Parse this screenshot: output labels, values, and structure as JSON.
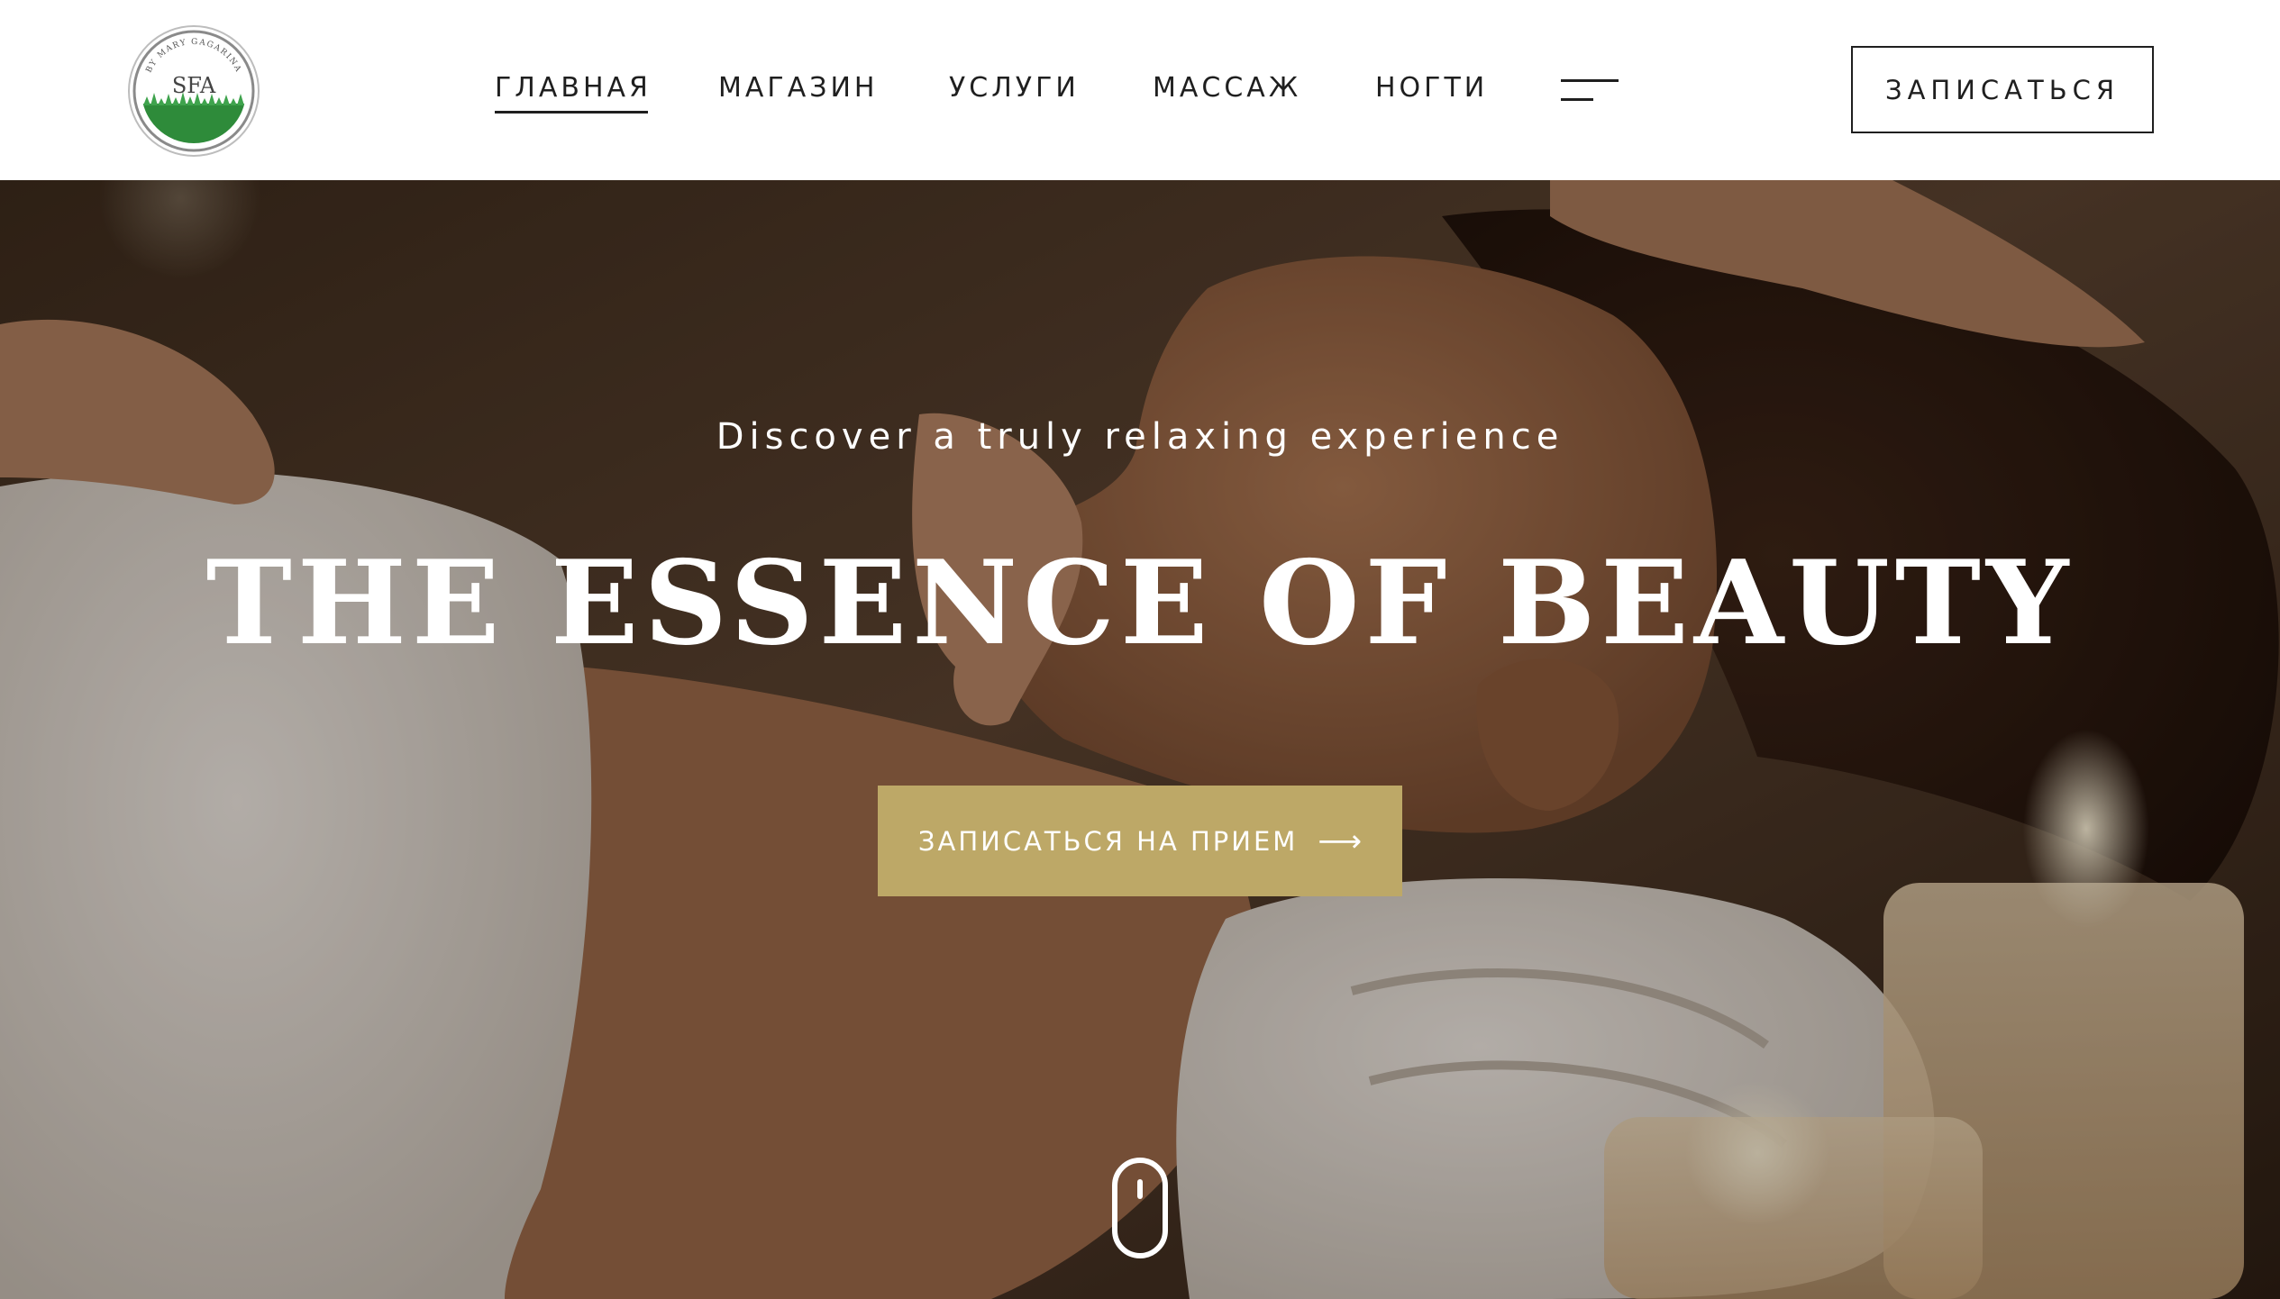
{
  "header": {
    "logo": {
      "text": "SFA",
      "ring_text": "BY MARY GAGARINA",
      "icon": "grass-logo-icon"
    },
    "nav": {
      "items": [
        {
          "label": "ГЛАВНАЯ",
          "active": true
        },
        {
          "label": "МАГАЗИН",
          "active": false
        },
        {
          "label": "УСЛУГИ",
          "active": false
        },
        {
          "label": "МАССАЖ",
          "active": false
        },
        {
          "label": "НОГТИ",
          "active": false
        }
      ],
      "menu_icon": "menu-lines-icon"
    },
    "cta_label": "ЗАПИСАТЬСЯ"
  },
  "hero": {
    "subtitle": "Discover a truly relaxing experience",
    "title": "THE ESSENCE OF BEAUTY",
    "cta_label": "ЗАПИСАТЬСЯ НА ПРИЕМ",
    "cta_icon": "arrow-right-icon",
    "scroll_icon": "mouse-scroll-icon"
  },
  "colors": {
    "accent": "#bda867",
    "text_dark": "#1f1f1f",
    "text_light": "#ffffff",
    "logo_green": "#2e8b3a"
  }
}
